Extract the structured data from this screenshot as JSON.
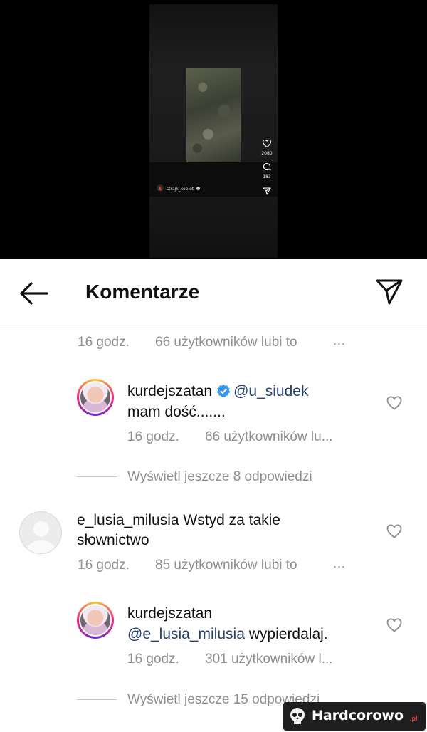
{
  "video": {
    "likes": "2080",
    "comments": "183",
    "username": "strajk_kobiet"
  },
  "header": {
    "title": "Komentarze"
  },
  "comments": [
    {
      "time": "16 godz.",
      "likes": "66 użytkowników lubi to",
      "more": "..."
    },
    {
      "username": "kurdejszatan",
      "mention": "@u_siudek",
      "text": "mam dość.......",
      "time": "16 godz.",
      "likes": "66 użytkowników lu..."
    },
    {
      "view_replies": "Wyświetl jeszcze 8 odpowiedzi"
    },
    {
      "username": "e_lusia_milusia",
      "text_line1": "Wstyd za takie",
      "text_line2": "słownictwo",
      "time": "16 godz.",
      "likes": "85 użytkowników lubi to",
      "more": "..."
    },
    {
      "username": "kurdejszatan",
      "mention": "@e_lusia_milusia",
      "text": "wypierdalaj.",
      "time": "16 godz.",
      "likes": "301 użytkowników l..."
    },
    {
      "view_replies": "Wyświetl jeszcze 15 odpowiedzi"
    }
  ],
  "watermark": {
    "text": "Hardcorowo",
    "suffix": ".pl"
  },
  "colors": {
    "mention": "#27406f",
    "verified": "#3897f0",
    "meta": "#8e8e8e"
  },
  "icons": [
    "back-arrow-icon",
    "send-icon",
    "heart-icon",
    "verified-icon",
    "comment-icon"
  ]
}
